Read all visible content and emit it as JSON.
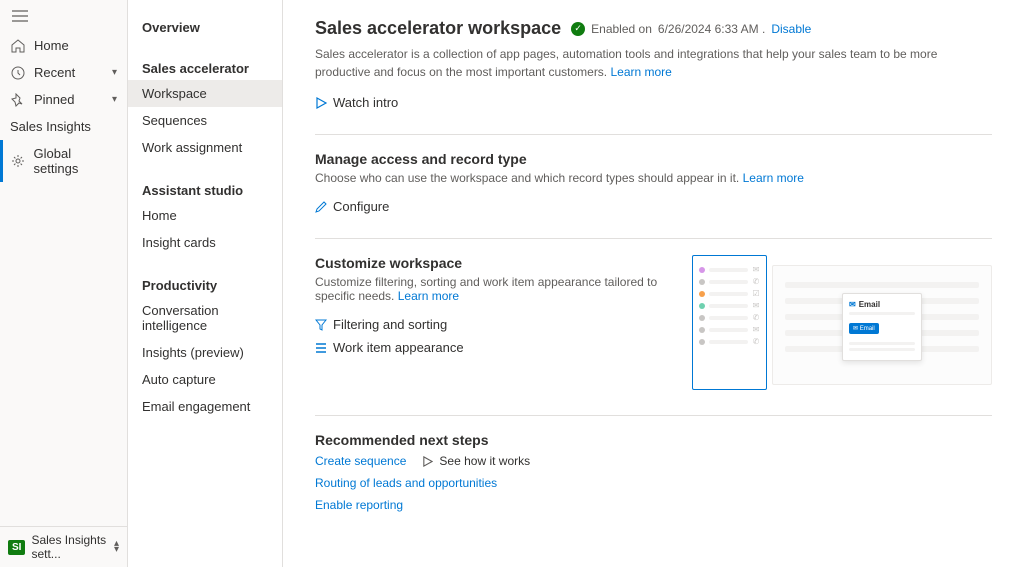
{
  "rail": {
    "home": "Home",
    "recent": "Recent",
    "pinned": "Pinned",
    "sales_insights": "Sales Insights",
    "global_settings": "Global settings",
    "footer_badge": "SI",
    "footer_label": "Sales Insights sett..."
  },
  "secnav": {
    "overview": "Overview",
    "group_sa": "Sales accelerator",
    "workspace": "Workspace",
    "sequences": "Sequences",
    "work_assignment": "Work assignment",
    "group_as": "Assistant studio",
    "as_home": "Home",
    "insight_cards": "Insight cards",
    "group_prod": "Productivity",
    "conv_intel": "Conversation intelligence",
    "insights_preview": "Insights (preview)",
    "auto_capture": "Auto capture",
    "email_eng": "Email engagement"
  },
  "main": {
    "title": "Sales accelerator workspace",
    "status_label": "Enabled on",
    "status_date": "6/26/2024 6:33 AM .",
    "disable": "Disable",
    "desc1": "Sales accelerator is a collection of app pages, automation tools and integrations that help your sales team to be more productive and focus on the most important customers. ",
    "learn_more": "Learn more",
    "watch_intro": "Watch intro",
    "access": {
      "title": "Manage access and record type",
      "desc": "Choose who can use the workspace and which record types should appear in it. ",
      "configure": "Configure"
    },
    "customize": {
      "title": "Customize workspace",
      "desc": "Customize filtering, sorting and work item appearance tailored to specific needs. ",
      "filter_sort": "Filtering and sorting",
      "work_item": "Work item appearance",
      "card_label": "Email",
      "card_btn": "Email"
    },
    "next": {
      "title": "Recommended next steps",
      "create_seq": "Create sequence",
      "see_how": "See how it works",
      "routing": "Routing of leads and opportunities",
      "enable_rep": "Enable reporting"
    }
  }
}
